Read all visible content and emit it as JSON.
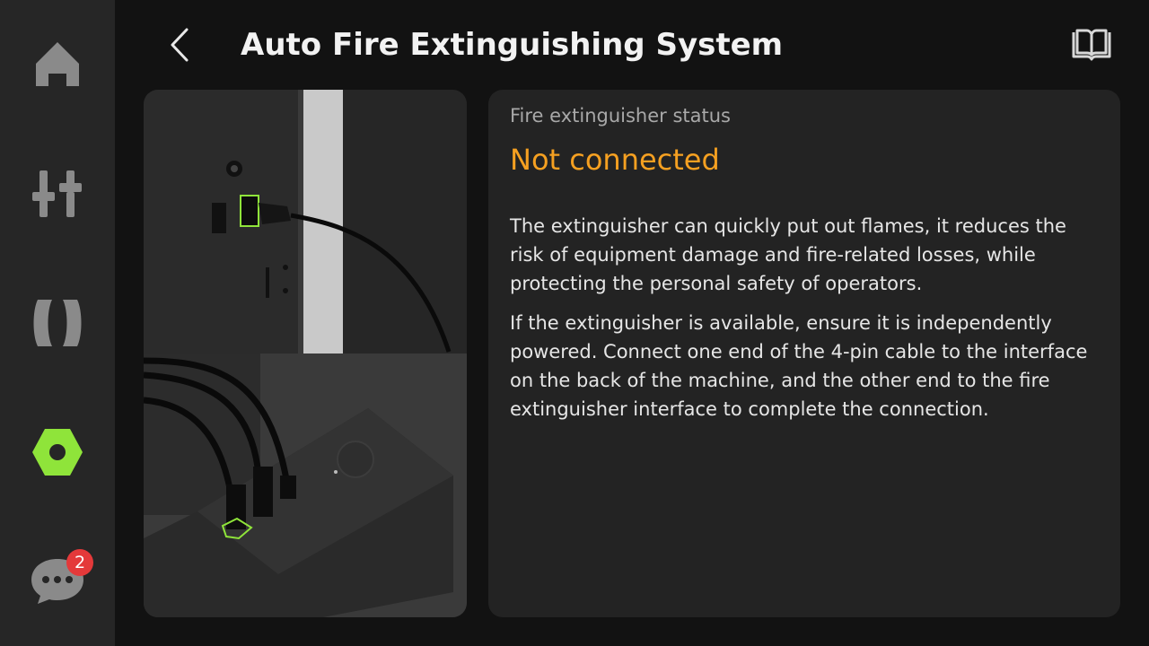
{
  "header": {
    "title": "Auto Fire Extinguishing System",
    "back_icon": "chevron-left-icon",
    "manual_icon": "open-book-icon"
  },
  "sidebar": {
    "items": [
      {
        "id": "home",
        "icon": "home-icon",
        "active": false
      },
      {
        "id": "tune",
        "icon": "sliders-icon",
        "active": false
      },
      {
        "id": "extruder",
        "icon": "nozzle-icon",
        "active": false
      },
      {
        "id": "settings",
        "icon": "hex-nut-settings-icon",
        "active": true
      },
      {
        "id": "messages",
        "icon": "chat-bubble-icon",
        "active": false,
        "badge": "2"
      }
    ]
  },
  "status": {
    "label": "Fire extinguisher status",
    "value": "Not connected"
  },
  "description": {
    "paragraph1": "The extinguisher can quickly put out flames, it reduces the risk of equipment damage and fire-related losses, while protecting the personal safety of operators.",
    "paragraph2": "If the extinguisher is available, ensure it is independently powered. Connect one end of the 4-pin cable to the interface on the back of the machine, and the other end to the fire extinguisher interface to complete the connection."
  },
  "colors": {
    "accent_green": "#8fe43a",
    "status_orange": "#f5a021",
    "badge_red": "#e4393a",
    "icon_gray": "#8a8a8a"
  }
}
